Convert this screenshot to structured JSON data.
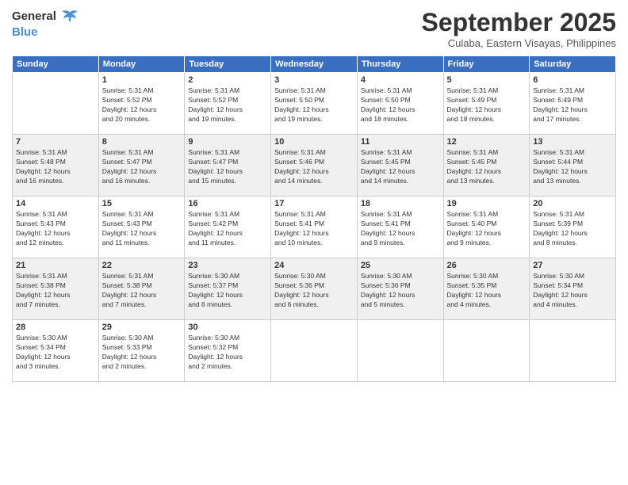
{
  "header": {
    "logo_general": "General",
    "logo_blue": "Blue",
    "month": "September 2025",
    "location": "Culaba, Eastern Visayas, Philippines"
  },
  "weekdays": [
    "Sunday",
    "Monday",
    "Tuesday",
    "Wednesday",
    "Thursday",
    "Friday",
    "Saturday"
  ],
  "weeks": [
    [
      {
        "day": "",
        "info": ""
      },
      {
        "day": "1",
        "info": "Sunrise: 5:31 AM\nSunset: 5:52 PM\nDaylight: 12 hours\nand 20 minutes."
      },
      {
        "day": "2",
        "info": "Sunrise: 5:31 AM\nSunset: 5:52 PM\nDaylight: 12 hours\nand 19 minutes."
      },
      {
        "day": "3",
        "info": "Sunrise: 5:31 AM\nSunset: 5:50 PM\nDaylight: 12 hours\nand 19 minutes."
      },
      {
        "day": "4",
        "info": "Sunrise: 5:31 AM\nSunset: 5:50 PM\nDaylight: 12 hours\nand 18 minutes."
      },
      {
        "day": "5",
        "info": "Sunrise: 5:31 AM\nSunset: 5:49 PM\nDaylight: 12 hours\nand 18 minutes."
      },
      {
        "day": "6",
        "info": "Sunrise: 5:31 AM\nSunset: 5:49 PM\nDaylight: 12 hours\nand 17 minutes."
      }
    ],
    [
      {
        "day": "7",
        "info": "Sunrise: 5:31 AM\nSunset: 5:48 PM\nDaylight: 12 hours\nand 16 minutes."
      },
      {
        "day": "8",
        "info": "Sunrise: 5:31 AM\nSunset: 5:47 PM\nDaylight: 12 hours\nand 16 minutes."
      },
      {
        "day": "9",
        "info": "Sunrise: 5:31 AM\nSunset: 5:47 PM\nDaylight: 12 hours\nand 15 minutes."
      },
      {
        "day": "10",
        "info": "Sunrise: 5:31 AM\nSunset: 5:46 PM\nDaylight: 12 hours\nand 14 minutes."
      },
      {
        "day": "11",
        "info": "Sunrise: 5:31 AM\nSunset: 5:45 PM\nDaylight: 12 hours\nand 14 minutes."
      },
      {
        "day": "12",
        "info": "Sunrise: 5:31 AM\nSunset: 5:45 PM\nDaylight: 12 hours\nand 13 minutes."
      },
      {
        "day": "13",
        "info": "Sunrise: 5:31 AM\nSunset: 5:44 PM\nDaylight: 12 hours\nand 13 minutes."
      }
    ],
    [
      {
        "day": "14",
        "info": "Sunrise: 5:31 AM\nSunset: 5:43 PM\nDaylight: 12 hours\nand 12 minutes."
      },
      {
        "day": "15",
        "info": "Sunrise: 5:31 AM\nSunset: 5:43 PM\nDaylight: 12 hours\nand 11 minutes."
      },
      {
        "day": "16",
        "info": "Sunrise: 5:31 AM\nSunset: 5:42 PM\nDaylight: 12 hours\nand 11 minutes."
      },
      {
        "day": "17",
        "info": "Sunrise: 5:31 AM\nSunset: 5:41 PM\nDaylight: 12 hours\nand 10 minutes."
      },
      {
        "day": "18",
        "info": "Sunrise: 5:31 AM\nSunset: 5:41 PM\nDaylight: 12 hours\nand 9 minutes."
      },
      {
        "day": "19",
        "info": "Sunrise: 5:31 AM\nSunset: 5:40 PM\nDaylight: 12 hours\nand 9 minutes."
      },
      {
        "day": "20",
        "info": "Sunrise: 5:31 AM\nSunset: 5:39 PM\nDaylight: 12 hours\nand 8 minutes."
      }
    ],
    [
      {
        "day": "21",
        "info": "Sunrise: 5:31 AM\nSunset: 5:38 PM\nDaylight: 12 hours\nand 7 minutes."
      },
      {
        "day": "22",
        "info": "Sunrise: 5:31 AM\nSunset: 5:38 PM\nDaylight: 12 hours\nand 7 minutes."
      },
      {
        "day": "23",
        "info": "Sunrise: 5:30 AM\nSunset: 5:37 PM\nDaylight: 12 hours\nand 6 minutes."
      },
      {
        "day": "24",
        "info": "Sunrise: 5:30 AM\nSunset: 5:36 PM\nDaylight: 12 hours\nand 6 minutes."
      },
      {
        "day": "25",
        "info": "Sunrise: 5:30 AM\nSunset: 5:36 PM\nDaylight: 12 hours\nand 5 minutes."
      },
      {
        "day": "26",
        "info": "Sunrise: 5:30 AM\nSunset: 5:35 PM\nDaylight: 12 hours\nand 4 minutes."
      },
      {
        "day": "27",
        "info": "Sunrise: 5:30 AM\nSunset: 5:34 PM\nDaylight: 12 hours\nand 4 minutes."
      }
    ],
    [
      {
        "day": "28",
        "info": "Sunrise: 5:30 AM\nSunset: 5:34 PM\nDaylight: 12 hours\nand 3 minutes."
      },
      {
        "day": "29",
        "info": "Sunrise: 5:30 AM\nSunset: 5:33 PM\nDaylight: 12 hours\nand 2 minutes."
      },
      {
        "day": "30",
        "info": "Sunrise: 5:30 AM\nSunset: 5:32 PM\nDaylight: 12 hours\nand 2 minutes."
      },
      {
        "day": "",
        "info": ""
      },
      {
        "day": "",
        "info": ""
      },
      {
        "day": "",
        "info": ""
      },
      {
        "day": "",
        "info": ""
      }
    ]
  ]
}
